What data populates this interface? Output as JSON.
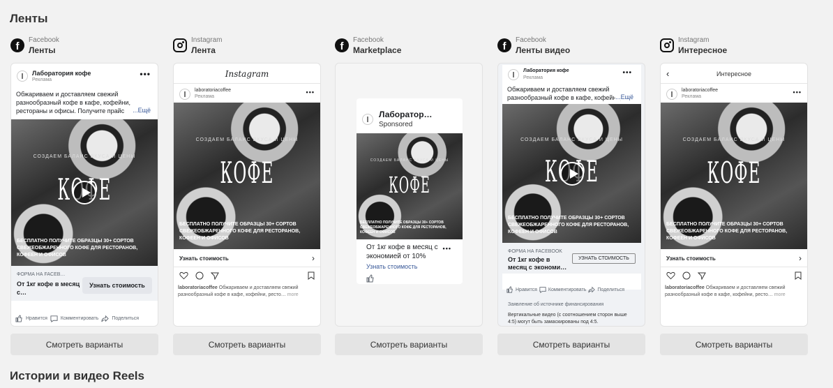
{
  "sections": {
    "feeds_title": "Ленты",
    "stories_title": "Истории и видео Reels"
  },
  "placements": [
    {
      "platform": "Facebook",
      "placement": "Ленты",
      "icon": "facebook-icon",
      "button": "Смотреть варианты"
    },
    {
      "platform": "Instagram",
      "placement": "Лента",
      "icon": "instagram-icon",
      "button": "Смотреть варианты"
    },
    {
      "platform": "Facebook",
      "placement": "Marketplace",
      "icon": "facebook-icon",
      "button": "Смотреть варианты"
    },
    {
      "platform": "Facebook",
      "placement": "Ленты видео",
      "icon": "facebook-icon",
      "button": "Смотреть варианты"
    },
    {
      "platform": "Instagram",
      "placement": "Интересное",
      "icon": "instagram-icon",
      "button": "Смотреть варианты"
    }
  ],
  "ad": {
    "page_name": "Лаборатория кофе",
    "page_name_short": "Лаборатор…",
    "ig_account": "laboratoriacoffee",
    "sponsored_ru": "Реклама",
    "sponsored_en": "Sponsored",
    "image_tag": "СОЗДАЕМ БАЛАНС ВКУСА И ЦЕНЫ",
    "image_title": "КОФЕ",
    "image_promo": "БЕСПЛАТНО ПОЛУЧИТЕ ОБРАЗЦЫ 30+ СОРТОВ СВЕЖЕОБЖАРЕННОГО КОФЕ ДЛЯ РЕСТОРАНОВ, КОФЕЕН И ОФИСОВ",
    "primary_text_full": "Обжариваем и доставляем свежий разнообразный кофе в кафе, кофейни, рестораны и офисы. Получите прайс",
    "primary_text_video": "Обжариваем и доставляем свежий разнообразный кофе в кафе, кофейни,",
    "see_more": "...Ещё",
    "form_label": "ФОРМА НА FACEB…",
    "form_label_full": "ФОРМА НА FACEBOOK",
    "headline": "От 1кг кофе в месяц с…",
    "headline_video": "От 1кг кофе в месяц с экономи…",
    "headline_marketplace": "От 1кг кофе в месяц с экономией от 10%",
    "cta": "Узнать стоимость",
    "cta_caps": "УЗНАТЬ СТОИМОСТЬ",
    "ig_caption": "Обжариваем и доставляем свежий разнообразный кофе в кафе, кофейни, ресто…",
    "more": "more",
    "like": "Нравится",
    "comment": "Комментировать",
    "share": "Поделиться",
    "instagram_wordmark": "Instagram",
    "explore_title": "Интересное",
    "funding_source": "Заявление об источнике финансирования",
    "video_note": "Вертикальные видео (с соотношением сторон выше 4:5) могут быть замаскированы под 4:5."
  }
}
